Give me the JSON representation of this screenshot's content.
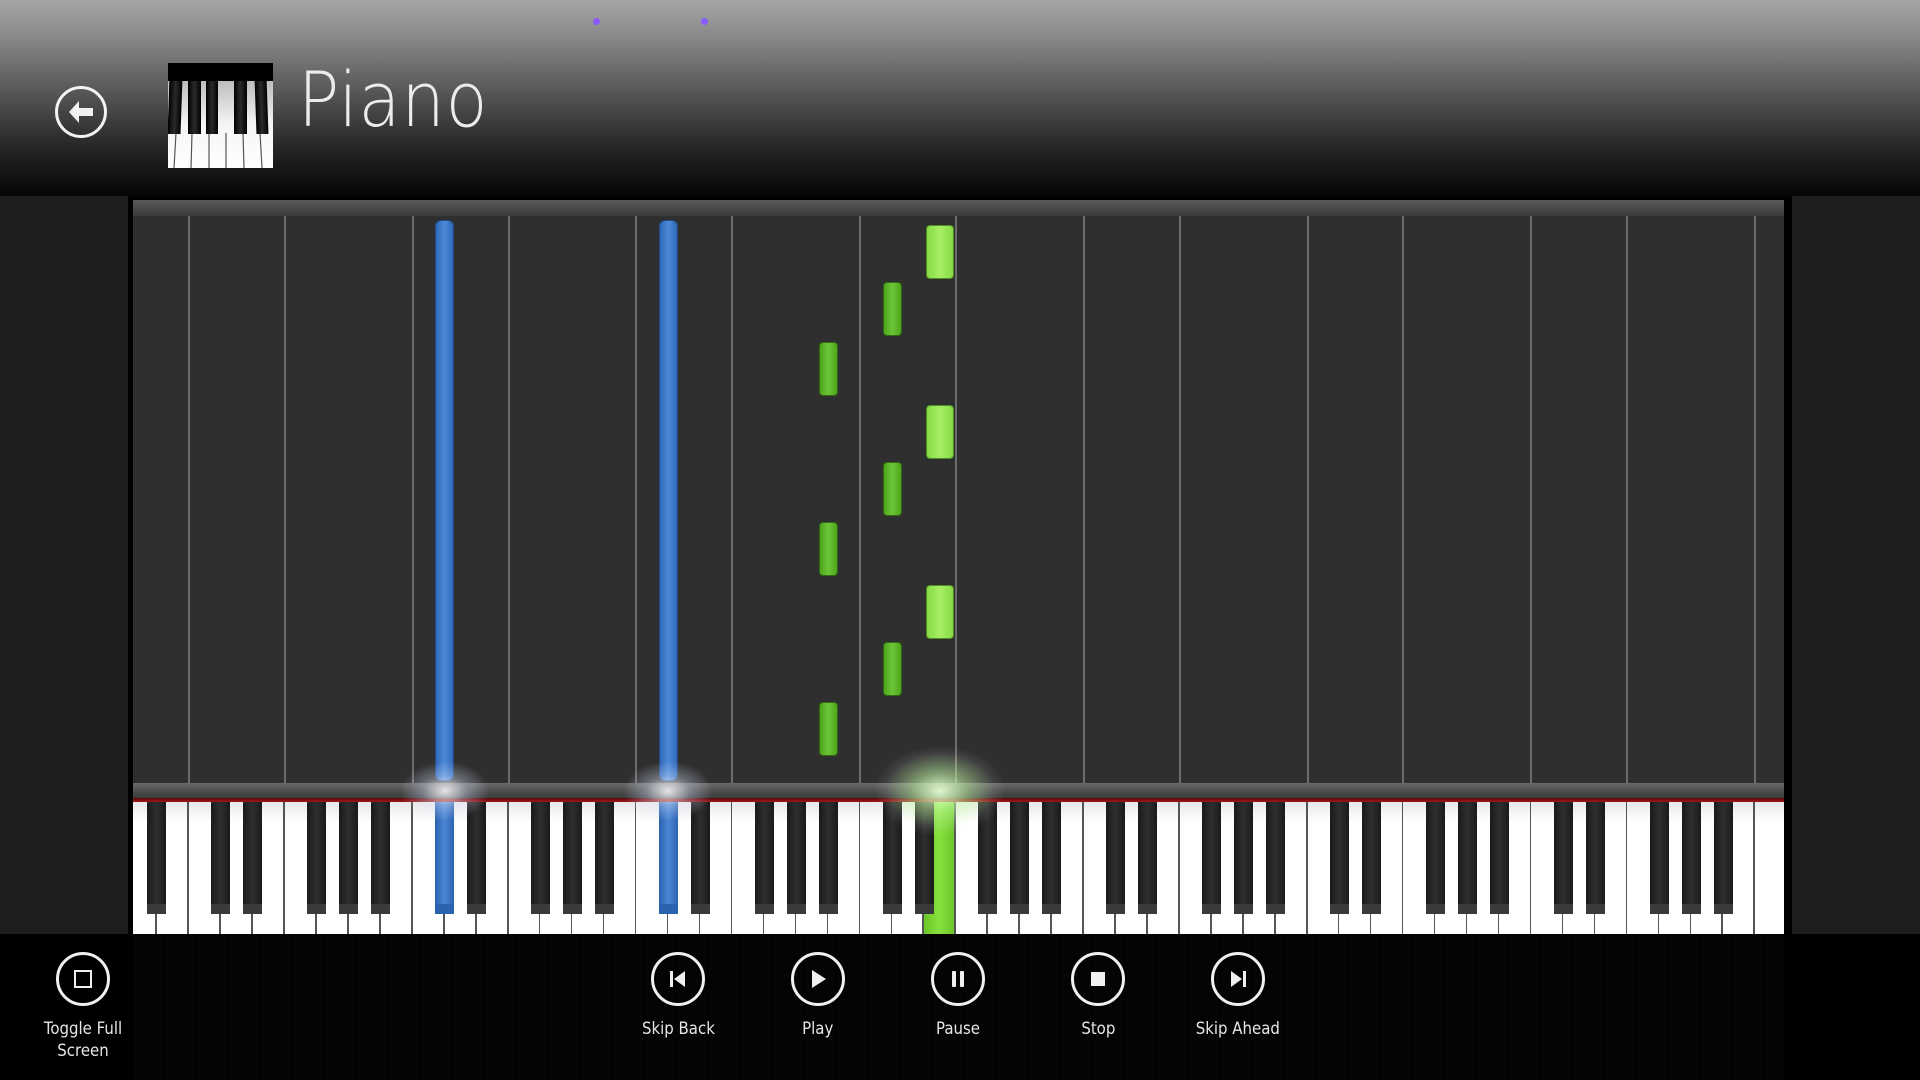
{
  "header": {
    "title": "Piano",
    "back_label": "Back",
    "thumbnail_alt": "Piano keys thumbnail",
    "loading_dots": 2
  },
  "colors": {
    "progress_dot": "#8a5cff",
    "note_green_white_key": "#92e34e",
    "note_green_black_key": "#5cb82a",
    "note_blue": "#3f7fd0",
    "pressed_green": "#7fdc2e"
  },
  "video": {
    "description": "Synthesia-style falling-notes piano tutorial",
    "keyboard": {
      "first_key": "A0",
      "last_key": "C8",
      "white_key_count": 52
    },
    "visible_time_window": 9.45,
    "notes": [
      {
        "pitch": "C#2",
        "hand": "left",
        "color": "blue",
        "start": -1.0,
        "duration": 12
      },
      {
        "pitch": "C#3",
        "hand": "left",
        "color": "blue",
        "start": -1.0,
        "duration": 12
      },
      {
        "pitch": "A#3",
        "hand": "right",
        "color": "green",
        "start": 0.45,
        "duration": 0.9
      },
      {
        "pitch": "C#4",
        "hand": "right",
        "color": "green",
        "start": 1.45,
        "duration": 0.9
      },
      {
        "pitch": "E4",
        "hand": "right",
        "color": "green",
        "start": 2.4,
        "duration": 0.9
      },
      {
        "pitch": "A#3",
        "hand": "right",
        "color": "green",
        "start": 3.45,
        "duration": 0.9
      },
      {
        "pitch": "C#4",
        "hand": "right",
        "color": "green",
        "start": 4.45,
        "duration": 0.9
      },
      {
        "pitch": "E4",
        "hand": "right",
        "color": "green",
        "start": 5.4,
        "duration": 0.9
      },
      {
        "pitch": "A#3",
        "hand": "right",
        "color": "green",
        "start": 6.45,
        "duration": 0.9
      },
      {
        "pitch": "C#4",
        "hand": "right",
        "color": "green",
        "start": 7.45,
        "duration": 0.9
      },
      {
        "pitch": "E4",
        "hand": "right",
        "color": "green",
        "start": 8.4,
        "duration": 0.9
      }
    ],
    "pressed_keys": [
      {
        "pitch": "C#2",
        "color": "blue"
      },
      {
        "pitch": "C#3",
        "color": "blue"
      },
      {
        "pitch": "E4",
        "color": "green"
      }
    ]
  },
  "appbar": {
    "left": [
      {
        "id": "toggle-full-screen",
        "label": "Toggle Full Screen",
        "icon": "square-icon"
      }
    ],
    "center": [
      {
        "id": "skip-back",
        "label": "Skip Back",
        "icon": "skip-back-icon"
      },
      {
        "id": "play",
        "label": "Play",
        "icon": "play-icon"
      },
      {
        "id": "pause",
        "label": "Pause",
        "icon": "pause-icon"
      },
      {
        "id": "stop",
        "label": "Stop",
        "icon": "stop-icon"
      },
      {
        "id": "skip-ahead",
        "label": "Skip Ahead",
        "icon": "skip-ahead-icon"
      }
    ]
  }
}
